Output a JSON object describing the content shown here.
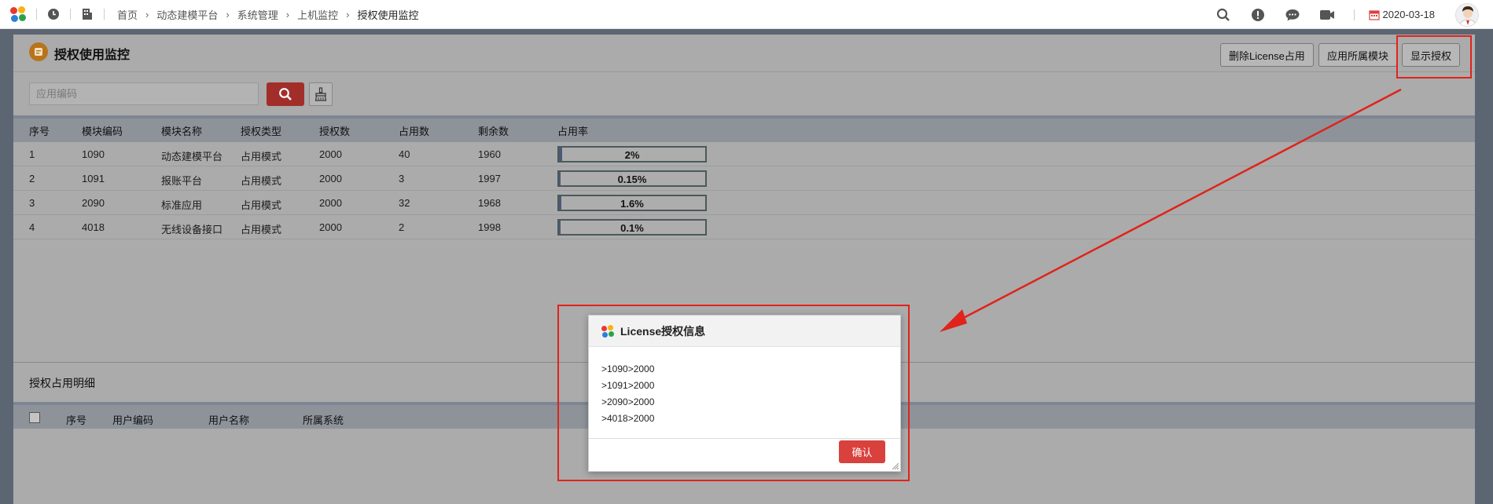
{
  "topbar": {
    "breadcrumbs": [
      "首页",
      "动态建模平台",
      "系统管理",
      "上机监控",
      "授权使用监控"
    ],
    "date": "2020-03-18",
    "brand_colors": [
      "#e8392e",
      "#f6b20f",
      "#2aa348",
      "#2a7fd6"
    ]
  },
  "panel": {
    "title": "授权使用监控",
    "buttons": {
      "delete_license": "删除License占用",
      "module_belong": "应用所属模块",
      "show_license": "显示授权"
    },
    "search_placeholder": "应用编码"
  },
  "table": {
    "columns": [
      "序号",
      "模块编码",
      "模块名称",
      "授权类型",
      "授权数",
      "占用数",
      "剩余数",
      "占用率"
    ],
    "rows": [
      {
        "no": "1",
        "code": "1090",
        "name": "动态建模平台",
        "type": "占用模式",
        "total": "2000",
        "used": "40",
        "remain": "1960",
        "rate": "2%",
        "rate_value": 0.02
      },
      {
        "no": "2",
        "code": "1091",
        "name": "报账平台",
        "type": "占用模式",
        "total": "2000",
        "used": "3",
        "remain": "1997",
        "rate": "0.15%",
        "rate_value": 0.0015
      },
      {
        "no": "3",
        "code": "2090",
        "name": "标准应用",
        "type": "占用模式",
        "total": "2000",
        "used": "32",
        "remain": "1968",
        "rate": "1.6%",
        "rate_value": 0.016
      },
      {
        "no": "4",
        "code": "4018",
        "name": "无线设备接口",
        "type": "占用模式",
        "total": "2000",
        "used": "2",
        "remain": "1998",
        "rate": "0.1%",
        "rate_value": 0.001
      }
    ]
  },
  "detail": {
    "title": "授权占用明细",
    "columns": [
      "序号",
      "用户编码",
      "用户名称",
      "所属系统"
    ]
  },
  "dialog": {
    "title": "License授权信息",
    "lines": [
      ">1090>2000",
      ">1091>2000",
      ">2090>2000",
      ">4018>2000"
    ],
    "ok_label": "确认"
  },
  "colors": {
    "annotation_red": "#e0231b",
    "search_button": "#a22e2a",
    "confirm_button": "#d9413d"
  }
}
